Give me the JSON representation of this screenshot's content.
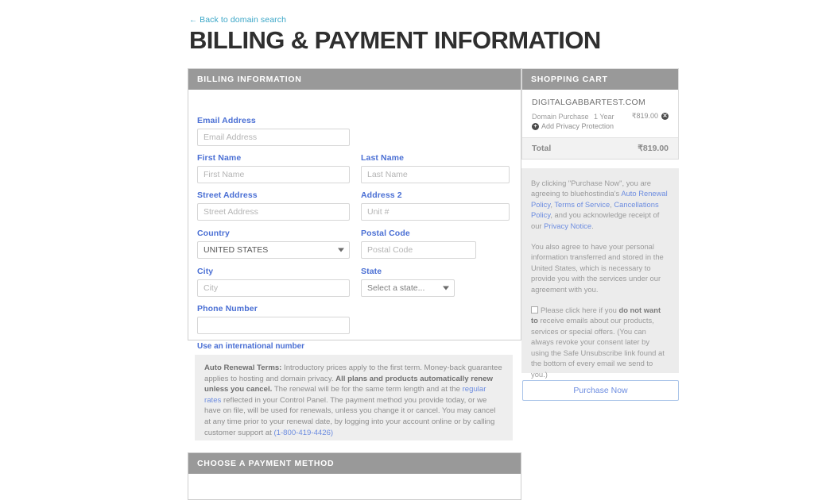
{
  "header": {
    "back_link": "Back to domain search",
    "back_arrow": "←",
    "title": "BILLING & PAYMENT INFORMATION"
  },
  "billing": {
    "section_title": "BILLING INFORMATION",
    "fields": {
      "email": {
        "label": "Email Address",
        "placeholder": "Email Address",
        "value": ""
      },
      "first_name": {
        "label": "First Name",
        "placeholder": "First Name",
        "value": ""
      },
      "last_name": {
        "label": "Last Name",
        "placeholder": "Last Name",
        "value": ""
      },
      "street": {
        "label": "Street Address",
        "placeholder": "Street Address",
        "value": ""
      },
      "address2": {
        "label": "Address 2",
        "placeholder": "Unit #",
        "value": ""
      },
      "country": {
        "label": "Country",
        "selected": "UNITED STATES"
      },
      "postal": {
        "label": "Postal Code",
        "placeholder": "Postal Code",
        "value": ""
      },
      "city": {
        "label": "City",
        "placeholder": "City",
        "value": ""
      },
      "state": {
        "label": "State",
        "selected": "Select a state..."
      },
      "phone": {
        "label": "Phone Number",
        "placeholder": "",
        "value": ""
      }
    },
    "international_link": "Use an international number"
  },
  "auto_renewal": {
    "heading": "Auto Renewal Terms:",
    "text_1": " Introductory prices apply to the first term. Money-back guarantee applies to hosting and domain privacy. ",
    "bold_1": "All plans and products automatically renew unless you cancel.",
    "text_2": " The renewal will be for the same term length and at the ",
    "link_rates": "regular rates",
    "text_3": " reflected in your Control Panel. The payment method you provide today, or we have on file, will be used for renewals, unless you change it or cancel. You may cancel at any time prior to your renewal date, by logging into your account online or by calling customer support at ",
    "link_phone": "(1-800-419-4426)"
  },
  "payment": {
    "section_title": "CHOOSE A PAYMENT METHOD"
  },
  "cart": {
    "section_title": "SHOPPING CART",
    "domain": "DIGITALGABBARTEST.COM",
    "item": {
      "description": "Domain Purchase",
      "term": "1 Year",
      "price": "₹819.00",
      "remove_icon": "✕"
    },
    "privacy": {
      "label": "Add Privacy Protection",
      "add_icon": "+"
    },
    "total_label": "Total",
    "total_value": "₹819.00"
  },
  "legal": {
    "p1_a": "By clicking \"Purchase Now\", you are agreeing to bluehostindia's ",
    "link_auto_renewal": "Auto Renewal Policy",
    "p1_b": ", ",
    "link_terms": "Terms of Service",
    "p1_c": ", ",
    "link_cancellations": "Cancellations Policy",
    "p1_d": ", and you acknowledge receipt of our ",
    "link_privacy": "Privacy Notice",
    "p1_e": ".",
    "p2": "You also agree to have your personal information transferred and stored in the United States, which is necessary to provide you with the services under our agreement with you.",
    "opt_a": "Please click here if you ",
    "opt_bold": "do not want to",
    "opt_b": " receive emails about our products, services or special offers. (You can always revoke your consent later by using the Safe Unsubscribe link found at the bottom of every email we send to you.)"
  },
  "purchase_button": "Purchase Now",
  "colors": {
    "panel_header": "#999999",
    "label_blue": "#4a6fd4",
    "link_blue": "#6d8de0",
    "back_link": "#3aa6c7",
    "legal_bg": "#ececec",
    "renew_bg": "#eeeeee"
  }
}
